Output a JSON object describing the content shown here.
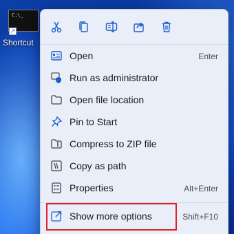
{
  "desktop": {
    "shortcut_label": "Shortcut",
    "terminal_text": "C:\\_"
  },
  "menu": {
    "quick_actions": [
      {
        "name": "cut",
        "icon": "scissors-icon"
      },
      {
        "name": "copy",
        "icon": "copy-icon"
      },
      {
        "name": "rename",
        "icon": "rename-icon"
      },
      {
        "name": "share",
        "icon": "share-icon"
      },
      {
        "name": "delete",
        "icon": "trash-icon"
      }
    ],
    "items": [
      {
        "label": "Open",
        "accel": "Enter",
        "icon": "open-window-icon"
      },
      {
        "label": "Run as administrator",
        "accel": "",
        "icon": "shield-icon"
      },
      {
        "label": "Open file location",
        "accel": "",
        "icon": "folder-icon"
      },
      {
        "label": "Pin to Start",
        "accel": "",
        "icon": "pin-icon"
      },
      {
        "label": "Compress to ZIP file",
        "accel": "",
        "icon": "zip-folder-icon"
      },
      {
        "label": "Copy as path",
        "accel": "",
        "icon": "path-icon"
      },
      {
        "label": "Properties",
        "accel": "Alt+Enter",
        "icon": "properties-icon"
      },
      {
        "label": "Show more options",
        "accel": "Shift+F10",
        "icon": "expand-icon"
      }
    ],
    "accent_color": "#1a5fd0",
    "highlight_color": "#e0202a"
  }
}
